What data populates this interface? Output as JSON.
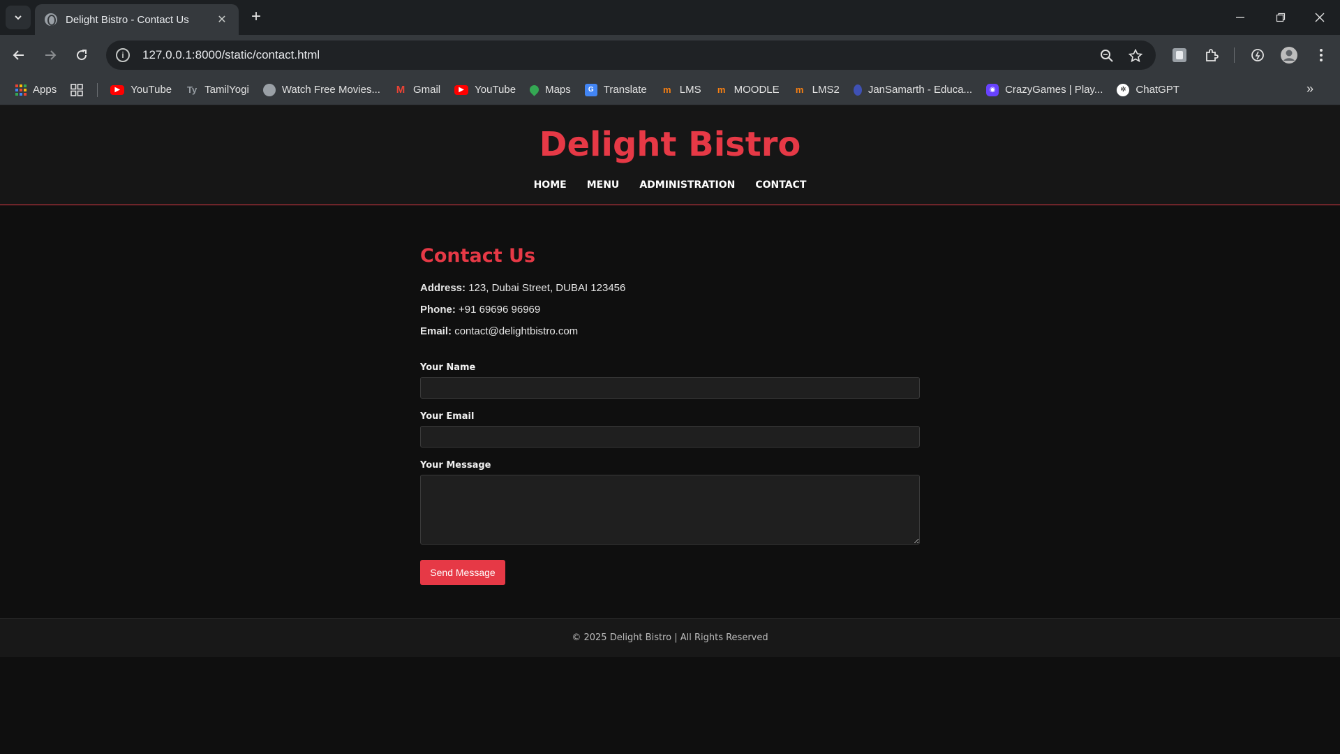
{
  "browser": {
    "tab_title": "Delight Bistro - Contact Us",
    "url": "127.0.0.1:8000/static/contact.html",
    "bookmarks": [
      {
        "label": "Apps",
        "icon": "apps-grid-icon",
        "color": "#4285f4"
      },
      {
        "label": "YouTube",
        "icon": "youtube-icon",
        "color": "#ff0000"
      },
      {
        "label": "TamilYogi",
        "icon": "tamilyogi-icon",
        "color": "#555555"
      },
      {
        "label": "Watch Free Movies...",
        "icon": "globe-icon",
        "color": "#9aa0a6"
      },
      {
        "label": "Gmail",
        "icon": "gmail-icon",
        "color": "#ea4335"
      },
      {
        "label": "YouTube",
        "icon": "youtube-icon",
        "color": "#ff0000"
      },
      {
        "label": "Maps",
        "icon": "maps-icon",
        "color": "#34a853"
      },
      {
        "label": "Translate",
        "icon": "translate-icon",
        "color": "#4285f4"
      },
      {
        "label": "LMS",
        "icon": "moodle-icon",
        "color": "#f98012"
      },
      {
        "label": "MOODLE",
        "icon": "moodle-icon",
        "color": "#f98012"
      },
      {
        "label": "LMS2",
        "icon": "moodle-icon",
        "color": "#f98012"
      },
      {
        "label": "JanSamarth - Educa...",
        "icon": "jansamarth-icon",
        "color": "#3f51b5"
      },
      {
        "label": "CrazyGames | Play...",
        "icon": "crazygames-icon",
        "color": "#6842ff"
      },
      {
        "label": "ChatGPT",
        "icon": "chatgpt-icon",
        "color": "#ffffff"
      }
    ]
  },
  "site": {
    "brand": "Delight Bistro",
    "nav": [
      "HOME",
      "MENU",
      "ADMINISTRATION",
      "CONTACT"
    ],
    "accent_color": "#e63946"
  },
  "contact": {
    "heading": "Contact Us",
    "address_label": "Address:",
    "address": "123, Dubai Street, DUBAI 123456",
    "phone_label": "Phone:",
    "phone": "+91 69696 96969",
    "email_label": "Email:",
    "email": "contact@delightbistro.com",
    "form": {
      "name_label": "Your Name",
      "email_label": "Your Email",
      "message_label": "Your Message",
      "name_value": "",
      "email_value": "",
      "message_value": "",
      "submit_label": "Send Message"
    }
  },
  "footer": {
    "text": "© 2025 Delight Bistro | All Rights Reserved"
  }
}
